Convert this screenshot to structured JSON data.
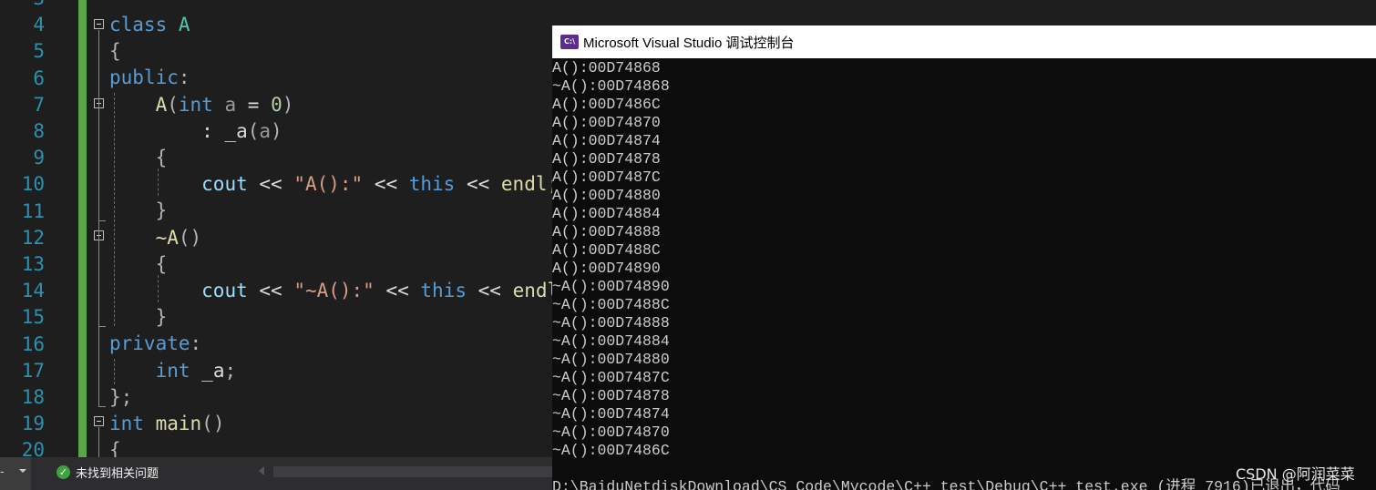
{
  "editor": {
    "line_numbers": [
      "3",
      "4",
      "5",
      "6",
      "7",
      "8",
      "9",
      "10",
      "11",
      "12",
      "13",
      "14",
      "15",
      "16",
      "17",
      "18",
      "19",
      "20"
    ],
    "code_lines": [
      [
        {
          "t": "kw",
          "v": "class"
        },
        {
          "t": "pl",
          "v": " "
        },
        {
          "t": "ty",
          "v": "A"
        }
      ],
      [
        {
          "t": "pu",
          "v": "{"
        }
      ],
      [
        {
          "t": "kw",
          "v": "public"
        },
        {
          "t": "pu",
          "v": ":"
        }
      ],
      [
        {
          "t": "pl",
          "v": "    "
        },
        {
          "t": "fn",
          "v": "A"
        },
        {
          "t": "pu",
          "v": "("
        },
        {
          "t": "kw",
          "v": "int"
        },
        {
          "t": "pl",
          "v": " "
        },
        {
          "t": "pa",
          "v": "a"
        },
        {
          "t": "pl",
          "v": " = "
        },
        {
          "t": "nm",
          "v": "0"
        },
        {
          "t": "pu",
          "v": ")"
        }
      ],
      [
        {
          "t": "pl",
          "v": "        : "
        },
        {
          "t": "mb",
          "v": "_a"
        },
        {
          "t": "pu",
          "v": "("
        },
        {
          "t": "pa",
          "v": "a"
        },
        {
          "t": "pu",
          "v": ")"
        }
      ],
      [
        {
          "t": "pl",
          "v": "    "
        },
        {
          "t": "pu",
          "v": "{"
        }
      ],
      [
        {
          "t": "pl",
          "v": "        "
        },
        {
          "t": "vr",
          "v": "cout"
        },
        {
          "t": "pl",
          "v": " << "
        },
        {
          "t": "st",
          "v": "\"A():\""
        },
        {
          "t": "pl",
          "v": " << "
        },
        {
          "t": "kw",
          "v": "this"
        },
        {
          "t": "pl",
          "v": " << "
        },
        {
          "t": "fn",
          "v": "endl"
        },
        {
          "t": "pu",
          "v": ";"
        }
      ],
      [
        {
          "t": "pl",
          "v": "    "
        },
        {
          "t": "pu",
          "v": "}"
        }
      ],
      [
        {
          "t": "pl",
          "v": "    "
        },
        {
          "t": "fn",
          "v": "~A"
        },
        {
          "t": "pu",
          "v": "()"
        }
      ],
      [
        {
          "t": "pl",
          "v": "    "
        },
        {
          "t": "pu",
          "v": "{"
        }
      ],
      [
        {
          "t": "pl",
          "v": "        "
        },
        {
          "t": "vr",
          "v": "cout"
        },
        {
          "t": "pl",
          "v": " << "
        },
        {
          "t": "st",
          "v": "\"~A():\""
        },
        {
          "t": "pl",
          "v": " << "
        },
        {
          "t": "kw",
          "v": "this"
        },
        {
          "t": "pl",
          "v": " << "
        },
        {
          "t": "fn",
          "v": "endl"
        },
        {
          "t": "pu",
          "v": ";"
        }
      ],
      [
        {
          "t": "pl",
          "v": "    "
        },
        {
          "t": "pu",
          "v": "}"
        }
      ],
      [
        {
          "t": "kw",
          "v": "private"
        },
        {
          "t": "pu",
          "v": ":"
        }
      ],
      [
        {
          "t": "pl",
          "v": "    "
        },
        {
          "t": "kw",
          "v": "int"
        },
        {
          "t": "pl",
          "v": " "
        },
        {
          "t": "mb",
          "v": "_a"
        },
        {
          "t": "pu",
          "v": ";"
        }
      ],
      [
        {
          "t": "pu",
          "v": "};"
        }
      ],
      [
        {
          "t": "kw",
          "v": "int"
        },
        {
          "t": "pl",
          "v": " "
        },
        {
          "t": "fn",
          "v": "main"
        },
        {
          "t": "pu",
          "v": "()"
        }
      ],
      [
        {
          "t": "pu",
          "v": "{"
        }
      ]
    ]
  },
  "statusbar": {
    "left_label": "-",
    "issues_text": "未找到相关问题",
    "issues_icon": "check-circle-icon"
  },
  "console": {
    "title": "Microsoft Visual Studio 调试控制台",
    "icon_label": "C:\\",
    "output_lines": [
      "A():00D74868",
      "~A():00D74868",
      "A():00D7486C",
      "A():00D74870",
      "A():00D74874",
      "A():00D74878",
      "A():00D7487C",
      "A():00D74880",
      "A():00D74884",
      "A():00D74888",
      "A():00D7488C",
      "A():00D74890",
      "~A():00D74890",
      "~A():00D7488C",
      "~A():00D74888",
      "~A():00D74884",
      "~A():00D74880",
      "~A():00D7487C",
      "~A():00D74878",
      "~A():00D74874",
      "~A():00D74870",
      "~A():00D7486C",
      "",
      "D:\\BaiduNetdiskDownload\\CS_Code\\Mycode\\C++_test\\Debug\\C++_test.exe (进程 7916)已退出，代码"
    ]
  },
  "watermark": "CSDN @阿润菜菜",
  "colors": {
    "editor_bg": "#1e1e1e",
    "line_number": "#2b91af",
    "keyword": "#569cd6",
    "type": "#4ec9b0",
    "function": "#dcdcaa",
    "string": "#d69d85",
    "number": "#b5cea8",
    "variable": "#9cdcfe",
    "change_bar": "#57a64a",
    "console_bg": "#0c0c0c",
    "console_text": "#cccccc",
    "vs_purple": "#5c2d91"
  }
}
